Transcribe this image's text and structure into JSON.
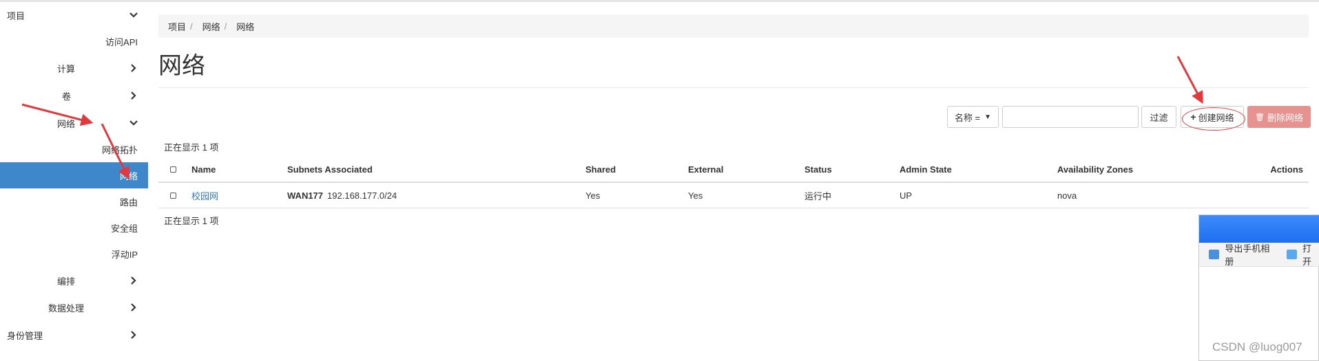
{
  "sidebar": {
    "items": [
      {
        "label": "项目",
        "chevron": "down"
      },
      {
        "label": "访问API"
      },
      {
        "label": "计算",
        "chevron": "right"
      },
      {
        "label": "卷",
        "chevron": "right"
      },
      {
        "label": "网络",
        "chevron": "down"
      },
      {
        "label": "网络拓扑"
      },
      {
        "label": "网络",
        "active": true
      },
      {
        "label": "路由"
      },
      {
        "label": "安全组"
      },
      {
        "label": "浮动IP"
      },
      {
        "label": "编排",
        "chevron": "right"
      },
      {
        "label": "数据处理",
        "chevron": "right"
      },
      {
        "label": "身份管理",
        "chevron": "right"
      }
    ]
  },
  "breadcrumb": [
    "项目",
    "网络",
    "网络"
  ],
  "page": {
    "title": "网络"
  },
  "filter": {
    "field_label": "名称 =",
    "input_value": "",
    "filter_button": "过滤",
    "create_button": "创建网络",
    "delete_button": "删除网络"
  },
  "table": {
    "count_top": "正在显示 1 项",
    "count_bottom": "正在显示 1 项",
    "headers": [
      "Name",
      "Subnets Associated",
      "Shared",
      "External",
      "Status",
      "Admin State",
      "Availability Zones",
      "Actions"
    ],
    "rows": [
      {
        "name": "校园网",
        "subnet_name": "WAN177",
        "subnet_cidr": "192.168.177.0/24",
        "shared": "Yes",
        "external": "Yes",
        "status": "运行中",
        "admin_state": "UP",
        "zones": "nova",
        "actions": ""
      }
    ]
  },
  "popup": {
    "export_label": "导出手机相册",
    "open_label": "打开"
  },
  "watermark": "CSDN @luog007",
  "colors": {
    "sidebar_active": "#3f87cb",
    "link": "#337ab7",
    "danger": "#e6928f",
    "annotation_red": "#e0393e"
  }
}
